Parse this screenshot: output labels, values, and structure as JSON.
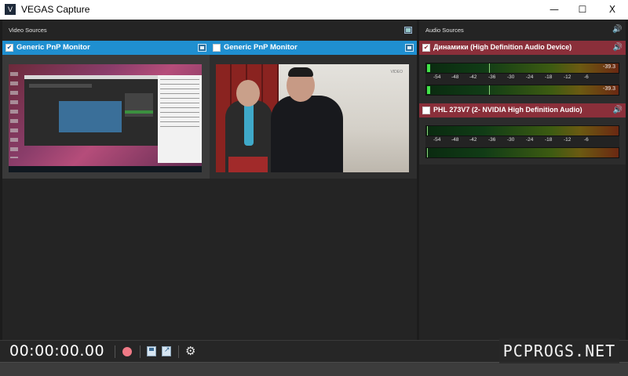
{
  "window": {
    "title": "VEGAS Capture",
    "app_icon": "V",
    "controls": {
      "minimize": "—",
      "maximize": "☐",
      "close": "X"
    }
  },
  "video_sources": {
    "header": "Video Sources",
    "cards": [
      {
        "title": "Generic PnP Monitor",
        "checked": true,
        "check_glyph": "✔"
      },
      {
        "title": "Generic PnP Monitor",
        "checked": false,
        "check_glyph": "",
        "preview_logo": "VIDEO"
      }
    ]
  },
  "audio_sources": {
    "header": "Audio Sources",
    "speaker_glyph": "🔊",
    "cards": [
      {
        "title": "Динамики (High Definition Audio Device)",
        "checked": true,
        "check_glyph": "✔",
        "meter_values": [
          "-39.3",
          "-39.3"
        ],
        "scale": [
          "-54",
          "-48",
          "-42",
          "-36",
          "-30",
          "-24",
          "-18",
          "-12",
          "-6"
        ]
      },
      {
        "title": "PHL 273V7 (2- NVIDIA High Definition Audio)",
        "checked": false,
        "check_glyph": "",
        "scale": [
          "-54",
          "-48",
          "-42",
          "-36",
          "-30",
          "-24",
          "-18",
          "-12",
          "-6"
        ]
      }
    ]
  },
  "transport": {
    "timecode": "00:00:00.00",
    "settings_glyph": "⚙"
  },
  "watermark": "PCPROGS.NET",
  "colors": {
    "video_header": "#1f8fd0",
    "audio_header": "#8a2f3a",
    "record": "#f07a86",
    "meter_level": "#43e24a"
  }
}
